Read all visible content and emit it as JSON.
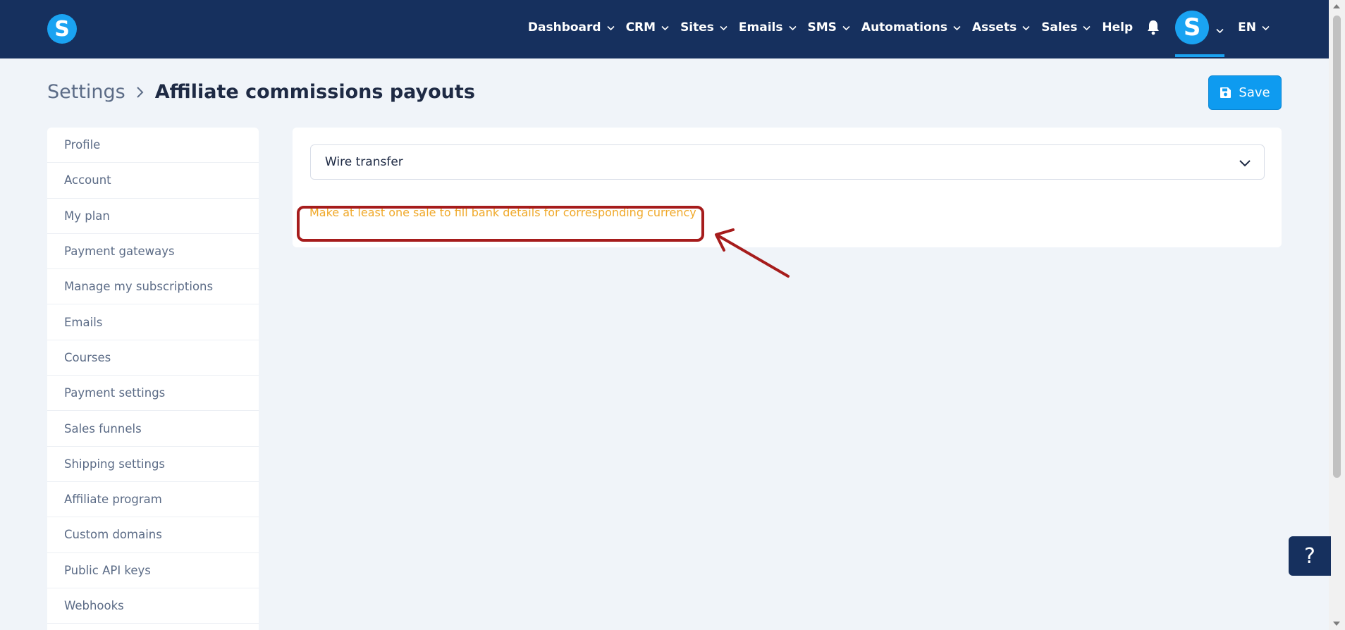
{
  "header": {
    "logo_letter": "S",
    "nav": [
      {
        "label": "Dashboard",
        "has_dropdown": true
      },
      {
        "label": "CRM",
        "has_dropdown": true
      },
      {
        "label": "Sites",
        "has_dropdown": true
      },
      {
        "label": "Emails",
        "has_dropdown": true
      },
      {
        "label": "SMS",
        "has_dropdown": true
      },
      {
        "label": "Automations",
        "has_dropdown": true
      },
      {
        "label": "Assets",
        "has_dropdown": true
      },
      {
        "label": "Sales",
        "has_dropdown": true
      },
      {
        "label": "Help",
        "has_dropdown": false
      }
    ],
    "avatar_letter": "S",
    "language": "EN"
  },
  "breadcrumb": {
    "parent": "Settings",
    "current": "Affiliate commissions payouts"
  },
  "toolbar": {
    "save_label": "Save"
  },
  "sidebar": {
    "items": [
      {
        "label": "Profile"
      },
      {
        "label": "Account"
      },
      {
        "label": "My plan"
      },
      {
        "label": "Payment gateways"
      },
      {
        "label": "Manage my subscriptions"
      },
      {
        "label": "Emails"
      },
      {
        "label": "Courses"
      },
      {
        "label": "Payment settings"
      },
      {
        "label": "Sales funnels"
      },
      {
        "label": "Shipping settings"
      },
      {
        "label": "Affiliate program"
      },
      {
        "label": "Custom domains"
      },
      {
        "label": "Public API keys"
      },
      {
        "label": "Webhooks"
      }
    ]
  },
  "main": {
    "payout_method": "Wire transfer",
    "warning": "Make at least one sale to fill bank details for corresponding currency"
  },
  "help_button": {
    "label": "?"
  },
  "colors": {
    "header_bg": "#16305e",
    "brand": "#1aa3f2",
    "save_button": "#0e9bf0",
    "warning_text": "#f0a92a",
    "annotation": "#a61c1c",
    "page_bg": "#f0f4f9"
  }
}
